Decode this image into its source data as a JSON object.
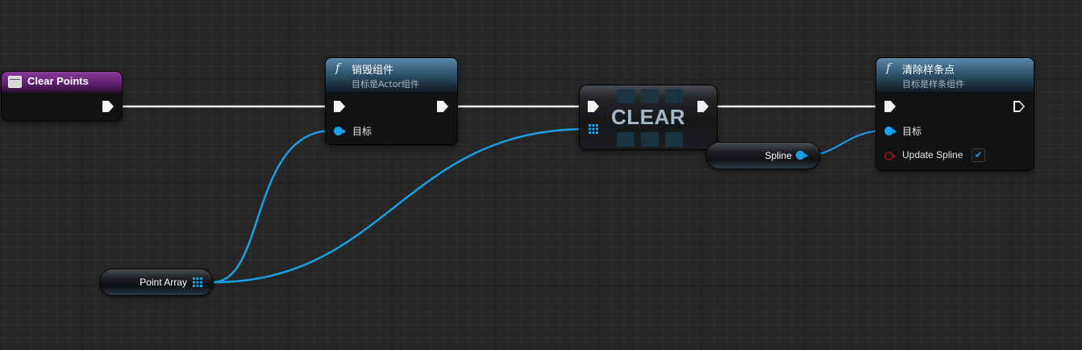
{
  "colors": {
    "exec_wire": "#f0f0f0",
    "object_wire": "#1aa0e8",
    "event_header": "#7a2f8a",
    "function_header": "#3c6685",
    "boolean_pin": "#8c1515"
  },
  "event_node": {
    "title": "Clear Points",
    "icon": "event-icon"
  },
  "destroy_node": {
    "icon": "function-icon",
    "glyph": "f",
    "title": "销毁组件",
    "subtitle": "目标是Actor组件",
    "target_label": "目标"
  },
  "clear_node": {
    "title": "CLEAR"
  },
  "clear_spline_node": {
    "icon": "function-icon",
    "glyph": "f",
    "title": "清除样条点",
    "subtitle": "目标是样条组件",
    "target_label": "目标",
    "update_label": "Update Spline",
    "update_checked": true,
    "check_mark": "✔"
  },
  "spline_var": {
    "label": "Spline"
  },
  "point_array_var": {
    "label": "Point Array"
  }
}
